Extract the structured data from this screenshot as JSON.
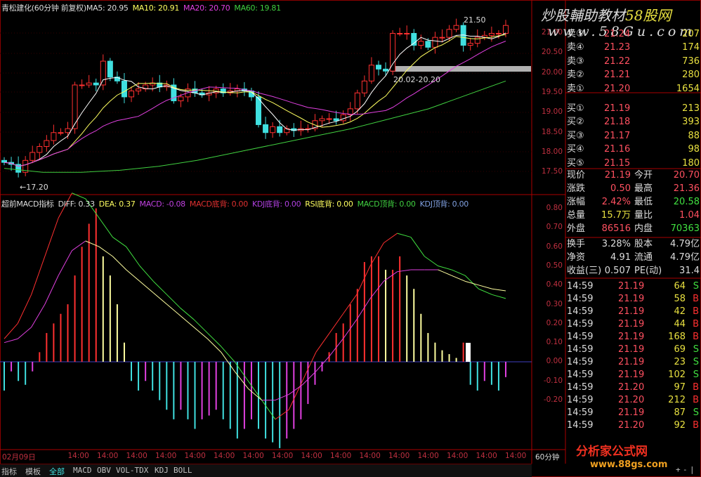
{
  "header": {
    "title": "青松建化(60分钟 前复权)",
    "ma5": "MA5: 20.95",
    "ma10": "MA10: 20.91",
    "ma20": "MA20: 20.70",
    "ma60": "MA60: 19.81"
  },
  "indicator_header": {
    "name": "超前MACD指标",
    "diff": "DIFF: 0.33",
    "dea": "DEA: 0.37",
    "macd": "MACD: -0.08",
    "macd_bottom": "MACD底背: 0.00",
    "kdj_bottom": "KDJ底背: 0.00",
    "rsi_bottom": "RSI底背: 0.00",
    "macd_top": "MACD顶背: 0.00",
    "kdj_top": "KDJ顶背: 0.00"
  },
  "colors": {
    "up": "#ff3030",
    "down": "#40e0e0",
    "ma5": "#ffffff",
    "ma10": "#ffff60",
    "ma20": "#e040e0",
    "ma60": "#40d040"
  },
  "chart_data": [
    {
      "type": "candlestick",
      "title": "青松建化 60分钟",
      "y_ticks": [
        "21.00",
        "20.50",
        "20.00",
        "19.50",
        "19.00",
        "18.50",
        "18.00",
        "17.50"
      ],
      "closes": [
        17.75,
        17.7,
        17.5,
        17.8,
        18.0,
        18.15,
        18.3,
        18.5,
        18.5,
        18.6,
        19.7,
        19.7,
        19.75,
        19.7,
        20.3,
        19.9,
        19.8,
        19.4,
        19.55,
        19.6,
        19.7,
        19.75,
        19.65,
        19.7,
        19.3,
        19.4,
        19.6,
        19.5,
        19.45,
        19.5,
        19.6,
        19.5,
        19.55,
        19.6,
        19.55,
        19.4,
        18.7,
        18.5,
        18.65,
        18.5,
        18.6,
        18.55,
        18.6,
        18.6,
        18.8,
        18.85,
        18.85,
        18.8,
        18.95,
        19.1,
        19.5,
        19.8,
        20.2,
        20.1,
        20.05,
        21.0,
        21.0,
        21.0,
        20.7,
        20.8,
        20.65,
        20.9,
        20.9,
        21.1,
        21.2,
        20.7,
        20.75,
        20.9,
        20.95,
        21.0,
        21.0,
        21.2
      ],
      "ma60": [
        17.6,
        17.5,
        17.5,
        17.55,
        17.65,
        17.8,
        18.0,
        18.2,
        18.4,
        18.6,
        18.85,
        19.1,
        19.45,
        19.8
      ],
      "annotations": {
        "low": "17.20",
        "high": "21.50",
        "zone": "20.02-20.20"
      }
    },
    {
      "type": "macd",
      "y_ticks": [
        "0.80",
        "0.70",
        "0.60",
        "0.50",
        "0.40",
        "0.30",
        "0.20",
        "0.10",
        "0.00",
        "-0.10",
        "-0.20"
      ],
      "histogram": [
        -0.15,
        -0.05,
        -0.1,
        -0.12,
        -0.05,
        0.05,
        0.15,
        0.2,
        0.25,
        0.3,
        0.45,
        0.6,
        0.72,
        0.8,
        0.55,
        0.45,
        0.3,
        0.1,
        -0.1,
        -0.15,
        -0.1,
        -0.15,
        -0.2,
        -0.25,
        -0.3,
        -0.25,
        -0.3,
        -0.35,
        -0.3,
        -0.28,
        -0.25,
        -0.3,
        -0.35,
        -0.4,
        -0.35,
        -0.3,
        -0.35,
        -0.4,
        -0.42,
        -0.45,
        -0.4,
        -0.35,
        -0.3,
        -0.22,
        -0.12,
        -0.05,
        0.05,
        0.15,
        0.2,
        0.3,
        0.38,
        0.52,
        0.55,
        0.55,
        0.48,
        0.48,
        0.55,
        0.45,
        0.38,
        0.25,
        0.15,
        0.1,
        0.06,
        0.04,
        0.02,
        0.1,
        -0.12,
        -0.15,
        -0.1,
        -0.12,
        -0.15,
        -0.08
      ],
      "diff": [
        0.12,
        0.2,
        0.35,
        0.55,
        0.75,
        0.88,
        0.85,
        0.75,
        0.65,
        0.6,
        0.5,
        0.42,
        0.35,
        0.28,
        0.22,
        0.15,
        0.08,
        0.0,
        -0.1,
        -0.2,
        -0.3,
        -0.25,
        -0.1,
        0.05,
        0.15,
        0.25,
        0.35,
        0.5,
        0.62,
        0.67,
        0.65,
        0.55,
        0.5,
        0.48,
        0.45,
        0.38,
        0.35,
        0.33
      ],
      "dea": [
        0.1,
        0.12,
        0.18,
        0.3,
        0.45,
        0.58,
        0.63,
        0.6,
        0.55,
        0.48,
        0.42,
        0.36,
        0.3,
        0.24,
        0.18,
        0.12,
        0.05,
        -0.05,
        -0.14,
        -0.2,
        -0.2,
        -0.17,
        -0.12,
        -0.05,
        0.03,
        0.12,
        0.22,
        0.33,
        0.42,
        0.47,
        0.48,
        0.48,
        0.48,
        0.45,
        0.42,
        0.4,
        0.38,
        0.37
      ]
    }
  ],
  "time_axis": [
    "02月09日",
    "14:00",
    "14:00",
    "14:00",
    "14:00",
    "14:00",
    "14:00",
    "14:00",
    "14:00",
    "14:00",
    "14:00",
    "14:00",
    "14:00",
    "14:00",
    "14:00",
    "14:00",
    "14:00"
  ],
  "period": "60分钟",
  "tabs": [
    "指标",
    "模板",
    "全部",
    "MACD",
    "OBV",
    "VOL-TDX",
    "KDJ",
    "BOLL"
  ],
  "zoom_buttons": [
    "+",
    "-",
    "|"
  ],
  "watermarks": {
    "top1": "炒股輔助教材",
    "top1b": "58股网",
    "top2": "www.58Gu.com",
    "bottom1": "分析家公式网",
    "bottom2": "www.88gs.com"
  },
  "orderbook": {
    "sell": [
      {
        "label": "卖⑤",
        "price": "21.24",
        "vol": "207"
      },
      {
        "label": "卖④",
        "price": "21.23",
        "vol": "174"
      },
      {
        "label": "卖③",
        "price": "21.22",
        "vol": "736"
      },
      {
        "label": "卖②",
        "price": "21.21",
        "vol": "280"
      },
      {
        "label": "卖①",
        "price": "21.20",
        "vol": "1654"
      }
    ],
    "buy": [
      {
        "label": "买①",
        "price": "21.19",
        "vol": "213"
      },
      {
        "label": "买②",
        "price": "21.18",
        "vol": "393"
      },
      {
        "label": "买③",
        "price": "21.17",
        "vol": "88"
      },
      {
        "label": "买④",
        "price": "21.16",
        "vol": "98"
      },
      {
        "label": "买⑤",
        "price": "21.15",
        "vol": "180"
      }
    ]
  },
  "quote": [
    {
      "l1": "现价",
      "v1": "21.19",
      "c1": "#ff5060",
      "l2": "今开",
      "v2": "20.70",
      "c2": "#ff5060"
    },
    {
      "l1": "涨跌",
      "v1": "0.50",
      "c1": "#ff5060",
      "l2": "最高",
      "v2": "21.36",
      "c2": "#ff5060"
    },
    {
      "l1": "涨幅",
      "v1": "2.42%",
      "c1": "#ff5060",
      "l2": "最低",
      "v2": "20.58",
      "c2": "#40e040"
    },
    {
      "l1": "总量",
      "v1": "15.7万",
      "c1": "#e8e040",
      "l2": "量比",
      "v2": "1.04",
      "c2": "#ff5060"
    },
    {
      "l1": "外盘",
      "v1": "86516",
      "c1": "#ff5060",
      "l2": "内盘",
      "v2": "70363",
      "c2": "#40e040"
    }
  ],
  "finance": [
    {
      "l1": "换手",
      "v1": "3.28%",
      "l2": "股本",
      "v2": "4.79亿"
    },
    {
      "l1": "净资",
      "v1": "4.91",
      "l2": "流通",
      "v2": "4.79亿"
    },
    {
      "l1": "收益(三)",
      "v1": "0.507",
      "l2": "PE(动)",
      "v2": "31.4"
    }
  ],
  "ticks": [
    {
      "t": "14:59",
      "p": "21.19",
      "v": "64",
      "s": "S"
    },
    {
      "t": "14:59",
      "p": "21.19",
      "v": "58",
      "s": "B"
    },
    {
      "t": "14:59",
      "p": "21.19",
      "v": "42",
      "s": "B"
    },
    {
      "t": "14:59",
      "p": "21.19",
      "v": "44",
      "s": "B"
    },
    {
      "t": "14:59",
      "p": "21.19",
      "v": "168",
      "s": "B"
    },
    {
      "t": "14:59",
      "p": "21.19",
      "v": "69",
      "s": "S"
    },
    {
      "t": "14:59",
      "p": "21.19",
      "v": "23",
      "s": "S"
    },
    {
      "t": "14:59",
      "p": "21.19",
      "v": "102",
      "s": "S"
    },
    {
      "t": "14:59",
      "p": "21.20",
      "v": "97",
      "s": "B"
    },
    {
      "t": "14:59",
      "p": "21.20",
      "v": "212",
      "s": "B"
    },
    {
      "t": "14:59",
      "p": "21.19",
      "v": "87",
      "s": "S"
    },
    {
      "t": "14:59",
      "p": "21.20",
      "v": "92",
      "s": "B"
    }
  ]
}
